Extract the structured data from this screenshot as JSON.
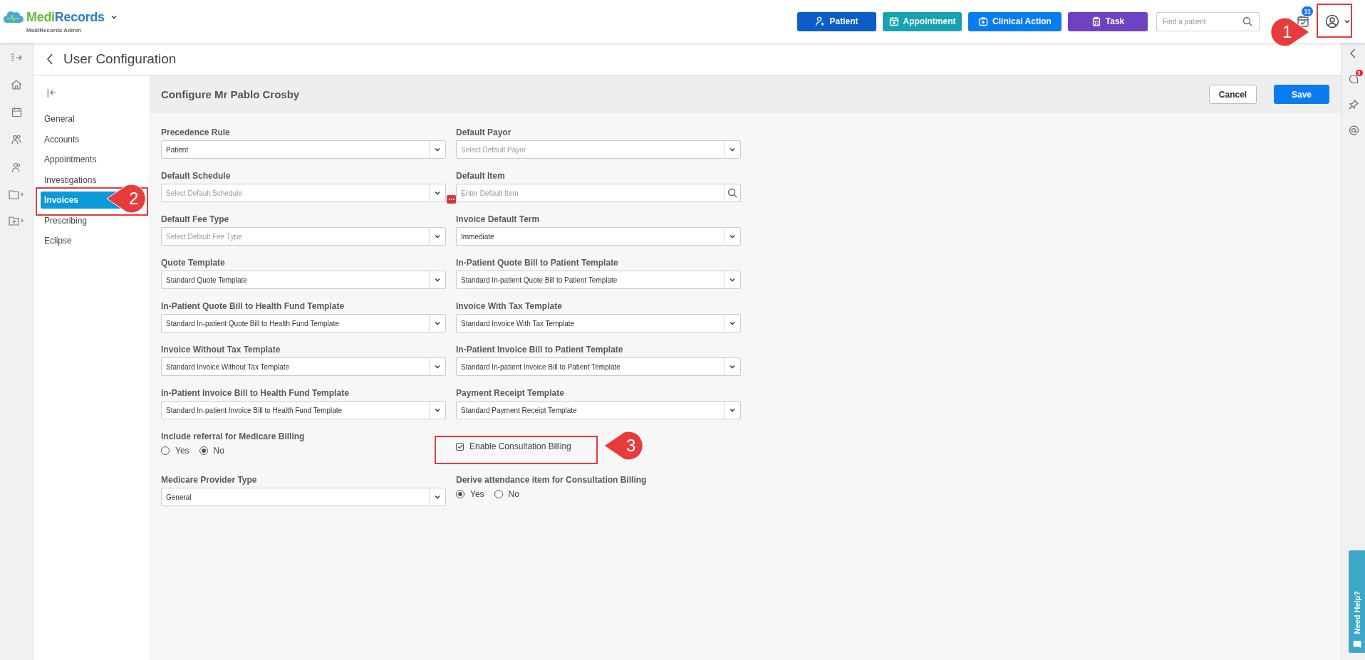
{
  "app": {
    "brand_first": "Medi",
    "brand_second": "Records",
    "subtitle": "MediRecords Admin"
  },
  "top_actions": [
    {
      "label": "Patient",
      "kind": "person",
      "color": "#0b5ec8"
    },
    {
      "label": "Appointment",
      "kind": "calendar",
      "color": "#17a2b0"
    },
    {
      "label": "Clinical Action",
      "kind": "medkit",
      "color": "#0a7cf2"
    },
    {
      "label": "Task",
      "kind": "clipboard",
      "color": "#6e42c1"
    }
  ],
  "search": {
    "placeholder": "Find a patient"
  },
  "task_badge": "11",
  "page_title": "User Configuration",
  "nav": [
    {
      "label": "General",
      "selected": false
    },
    {
      "label": "Accounts",
      "selected": false
    },
    {
      "label": "Appointments",
      "selected": false
    },
    {
      "label": "Investigations",
      "selected": false
    },
    {
      "label": "Invoices",
      "selected": true
    },
    {
      "label": "Prescribing",
      "selected": false
    },
    {
      "label": "Eclipse",
      "selected": false
    }
  ],
  "form": {
    "title": "Configure Mr Pablo Crosby",
    "buttons": [
      {
        "label": "Cancel",
        "kind": "secondary"
      },
      {
        "label": "Save",
        "kind": "primary"
      }
    ],
    "fields": [
      {
        "kind": "select",
        "label": "Precedence Rule",
        "value": "Patient"
      },
      {
        "kind": "select",
        "label": "Default Payor",
        "placeholder": "Select Default Payor"
      },
      {
        "kind": "select-more",
        "label": "Default Schedule",
        "placeholder": "Select Default Schedule"
      },
      {
        "kind": "search",
        "label": "Default Item",
        "placeholder": "Enter Default Item"
      },
      {
        "kind": "select",
        "label": "Default Fee Type",
        "placeholder": "Select Default Fee Type"
      },
      {
        "kind": "select",
        "label": "Invoice Default Term",
        "value": "Immediate"
      },
      {
        "kind": "select",
        "label": "Quote Template",
        "value": "Standard Quote Template"
      },
      {
        "kind": "select",
        "label": "In-Patient Quote Bill to Patient Template",
        "value": "Standard In-patient Quote Bill to Patient Template"
      },
      {
        "kind": "select",
        "label": "In-Patient Quote Bill to Health Fund Template",
        "value": "Standard In-patient Quote Bill to Health Fund Template"
      },
      {
        "kind": "select",
        "label": "Invoice With Tax Template",
        "value": "Standard Invoice With Tax Template"
      },
      {
        "kind": "select",
        "label": "Invoice Without Tax Template",
        "value": "Standard Invoice Without Tax Template"
      },
      {
        "kind": "select",
        "label": "In-Patient Invoice Bill to Patient Template",
        "value": "Standard In-patient Invoice Bill to Patient Template"
      },
      {
        "kind": "select",
        "label": "In-Patient Invoice Bill to Health Fund Template",
        "value": "Standard In-patient Invoice Bill to Health Fund Template"
      },
      {
        "kind": "select",
        "label": "Payment Receipt Template",
        "value": "Standard Payment Receipt Template"
      },
      {
        "kind": "radio",
        "label": "Include referral for Medicare Billing",
        "options": [
          {
            "label": "Yes",
            "selected": false
          },
          {
            "label": "No",
            "selected": true
          }
        ]
      },
      {
        "kind": "checkbox",
        "label": "Enable Consultation Billing",
        "checked": true
      },
      {
        "kind": "select",
        "label": "Medicare Provider Type",
        "value": "General"
      },
      {
        "kind": "radio",
        "label": "Derive attendance item for Consultation Billing",
        "options": [
          {
            "label": "Yes",
            "selected": true
          },
          {
            "label": "No",
            "selected": false
          }
        ]
      }
    ]
  },
  "right_rail": {
    "chat_badge": "5"
  },
  "help_tab": "Need Help?",
  "annotations": [
    {
      "number": "1"
    },
    {
      "number": "2"
    },
    {
      "number": "3"
    }
  ]
}
